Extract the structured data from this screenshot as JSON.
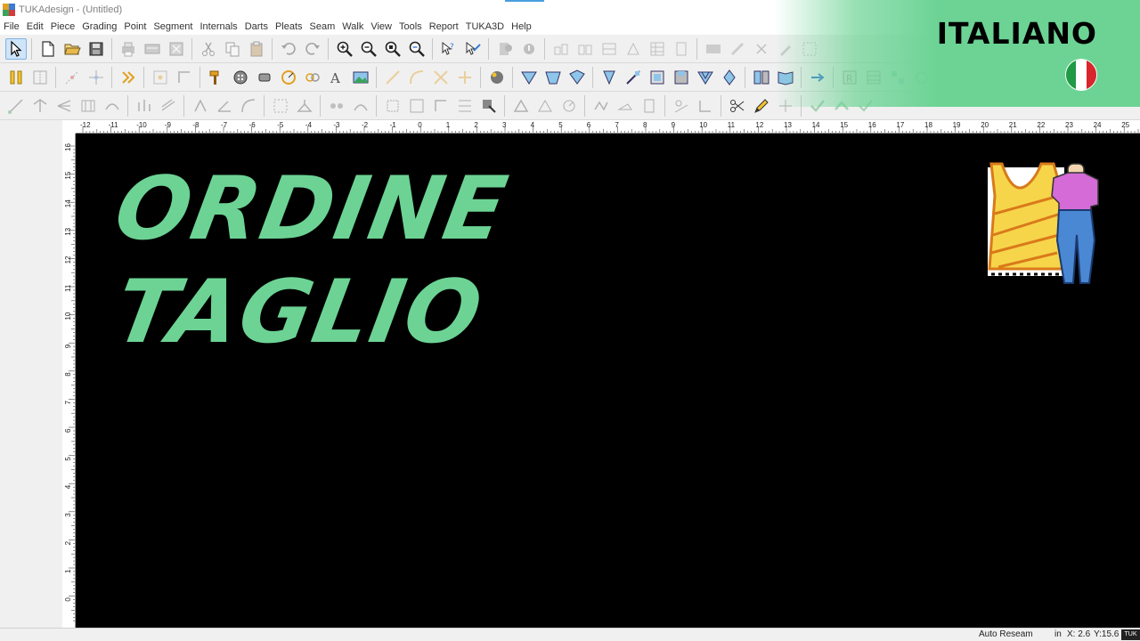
{
  "window": {
    "title": "TUKAdesign - (Untitled)"
  },
  "menu": [
    "File",
    "Edit",
    "Piece",
    "Grading",
    "Point",
    "Segment",
    "Internals",
    "Darts",
    "Pleats",
    "Seam",
    "Walk",
    "View",
    "Tools",
    "Report",
    "TUKA3D",
    "Help"
  ],
  "ruler_top_labels": [
    "-12",
    "-11",
    "-10",
    "-9",
    "-8",
    "-7",
    "-6",
    "-5",
    "-4",
    "-3",
    "-2",
    "-1",
    "0",
    "1",
    "2",
    "3",
    "4",
    "5",
    "6",
    "7",
    "8",
    "9",
    "10",
    "11",
    "12",
    "13",
    "14",
    "15",
    "16",
    "17",
    "18",
    "19",
    "20",
    "21",
    "22",
    "23",
    "24",
    "25"
  ],
  "ruler_left_labels": [
    "16",
    "15",
    "14",
    "13",
    "12",
    "11",
    "10",
    "9",
    "8",
    "7",
    "6",
    "5",
    "4",
    "3",
    "2",
    "1",
    "0"
  ],
  "canvas": {
    "headline_line1": "ORDINE",
    "headline_line2": "TAGLIO"
  },
  "overlay": {
    "language": "ITALIANO",
    "flag_colors": [
      "#1f9a45",
      "#ffffff",
      "#d8262c"
    ],
    "accent": "#6cd394"
  },
  "status": {
    "mode": "Auto Reseam",
    "unit": "in",
    "x": "X: 2.6",
    "y": "Y:15.6",
    "tag": "TUK"
  }
}
